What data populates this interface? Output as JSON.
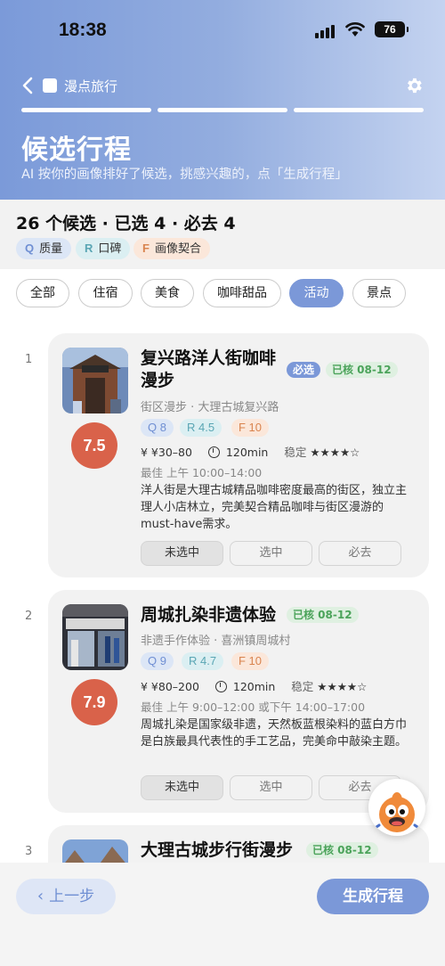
{
  "status_bar": {
    "time": "18:38",
    "battery": "76"
  },
  "nav": {
    "app_name": "漫点旅行"
  },
  "page": {
    "title": "候选行程",
    "subtitle": "AI 按你的画像排好了候选，挑感兴趣的，点「生成行程」"
  },
  "summary": {
    "text": "26 个候选 · 已选 4 · 必去 4",
    "legend": [
      {
        "key": "Q",
        "label": "质量"
      },
      {
        "key": "R",
        "label": "口碑"
      },
      {
        "key": "F",
        "label": "画像契合"
      }
    ]
  },
  "filters": [
    "全部",
    "住宿",
    "美食",
    "咖啡甜品",
    "活动",
    "景点"
  ],
  "active_filter": "活动",
  "colors": {
    "accent": "#7b98d8",
    "score": "#d9624a",
    "verified": "#4ba35a"
  },
  "cards": [
    {
      "index": "1",
      "name_line1": "复兴路洋人街咖啡",
      "name_line2": "漫步",
      "must_tag": "必选",
      "verified_tag": "已核 08-12",
      "score": "7.5",
      "category": "街区漫步 · 大理古城复兴路",
      "q": "Q 8",
      "r": "R 4.5",
      "f": "F 10",
      "price": "¥ ¥30–80",
      "duration": "120min",
      "stability_label": "稳定",
      "stars": "★★★★☆",
      "best_time": "最佳 上午 10:00–14:00",
      "desc": "洋人街是大理古城精品咖啡密度最高的街区，独立主理人小店林立，完美契合精品咖啡与街区漫游的must-have需求。",
      "btn_unselect": "未选中",
      "btn_select": "选中",
      "btn_must": "必去"
    },
    {
      "index": "2",
      "name_line1": "周城扎染非遗体验",
      "verified_tag": "已核 08-12",
      "score": "7.9",
      "category": "非遗手作体验 · 喜洲镇周城村",
      "q": "Q 9",
      "r": "R 4.7",
      "f": "F 10",
      "price": "¥ ¥80–200",
      "duration": "120min",
      "stability_label": "稳定",
      "stars": "★★★★☆",
      "best_time": "最佳 上午 9:00–12:00 或下午 14:00–17:00",
      "desc": "周城扎染是国家级非遗，天然板蓝根染料的蓝白方巾是白族最具代表性的手工艺品，完美命中敲染主题。",
      "btn_unselect": "未选中",
      "btn_select": "选中",
      "btn_must": "必去"
    },
    {
      "index": "3",
      "name_line1": "大理古城步行街漫步",
      "verified_tag": "已核 08-12"
    }
  ],
  "footer": {
    "prev": "上一步",
    "generate": "生成行程"
  }
}
